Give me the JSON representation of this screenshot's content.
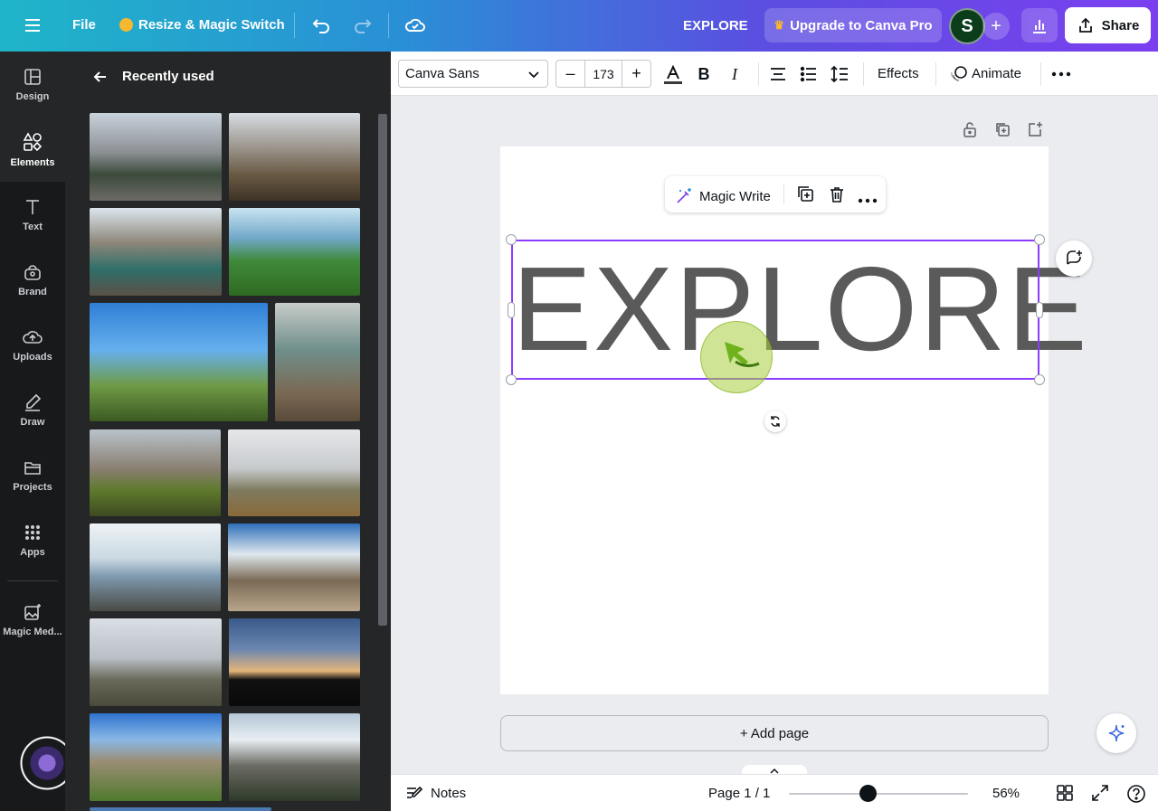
{
  "topbar": {
    "file_label": "File",
    "resize_label": "Resize & Magic Switch",
    "doc_title": "EXPLORE",
    "upgrade_label": "Upgrade to Canva Pro",
    "avatar_initial": "S",
    "share_label": "Share"
  },
  "rail": {
    "items": [
      {
        "label": "Design",
        "icon": "design-icon"
      },
      {
        "label": "Elements",
        "icon": "elements-icon"
      },
      {
        "label": "Text",
        "icon": "text-icon"
      },
      {
        "label": "Brand",
        "icon": "brand-icon"
      },
      {
        "label": "Uploads",
        "icon": "upload-icon"
      },
      {
        "label": "Draw",
        "icon": "draw-icon"
      },
      {
        "label": "Projects",
        "icon": "folder-icon"
      },
      {
        "label": "Apps",
        "icon": "apps-icon"
      },
      {
        "label": "Magic Med...",
        "icon": "magic-media-icon"
      }
    ]
  },
  "panel": {
    "title": "Recently used"
  },
  "toolbar": {
    "font": "Canva Sans",
    "font_size": "173",
    "effects_label": "Effects",
    "animate_label": "Animate"
  },
  "canvas": {
    "text": "EXPLORE",
    "magic_write_label": "Magic Write",
    "add_page_label": "+ Add page"
  },
  "bottombar": {
    "notes_label": "Notes",
    "page_count": "Page 1 / 1",
    "zoom": "56%",
    "zoom_fraction": 0.44
  },
  "colors": {
    "accent": "#8b3dff",
    "rail_bg": "#18191b",
    "panel_bg": "#252627",
    "text_fill": "#5a5a5a"
  }
}
